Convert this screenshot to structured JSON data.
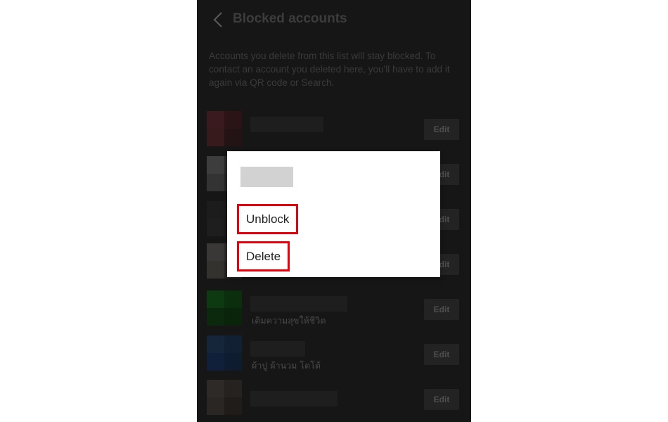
{
  "header": {
    "title": "Blocked accounts",
    "back_icon": "chevron-left-icon"
  },
  "description": "Accounts you delete from this list will stay blocked. To contact an account you deleted here, you'll have to add it again via QR code or Search.",
  "accounts": [
    {
      "edit_label": "Edit",
      "subtitle": ""
    },
    {
      "edit_label": "Edit",
      "subtitle": ""
    },
    {
      "edit_label": "Edit",
      "subtitle": ""
    },
    {
      "edit_label": "Edit",
      "subtitle": ""
    },
    {
      "edit_label": "Edit",
      "subtitle": "เติมความสุขให้ชีวิต"
    },
    {
      "edit_label": "Edit",
      "subtitle": "ผ้าปู ผ้านวม โตโต้"
    },
    {
      "edit_label": "Edit",
      "subtitle": ""
    }
  ],
  "dialog": {
    "unblock_label": "Unblock",
    "delete_label": "Delete"
  },
  "colors": {
    "background": "#161616",
    "highlight": "#e8000b",
    "dialog": "#ffffff"
  }
}
